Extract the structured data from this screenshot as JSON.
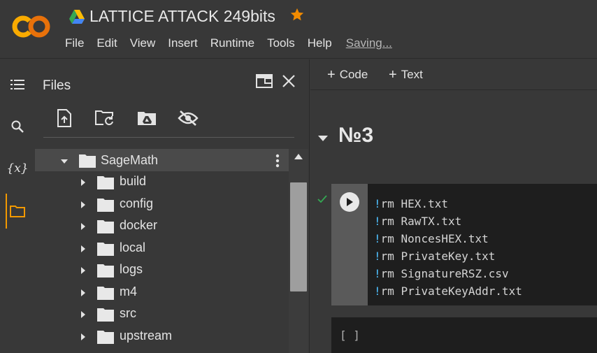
{
  "header": {
    "title": "LATTICE ATTACK 249bits",
    "menu": [
      "File",
      "Edit",
      "View",
      "Insert",
      "Runtime",
      "Tools",
      "Help"
    ],
    "saving": "Saving...",
    "star_color": "#f28b00"
  },
  "rail": {
    "var_label": "{x}",
    "active_color": "#f29900"
  },
  "files": {
    "title": "Files",
    "root": "SageMath",
    "folders": [
      "build",
      "config",
      "docker",
      "local",
      "logs",
      "m4",
      "src",
      "upstream"
    ]
  },
  "notebook": {
    "add_code": "Code",
    "add_text": "Text",
    "section_title": "№3",
    "code_lines": [
      {
        "bang": "!",
        "cmd": "rm HEX.txt"
      },
      {
        "bang": "!",
        "cmd": "rm RawTX.txt"
      },
      {
        "bang": "!",
        "cmd": "rm NoncesHEX.txt"
      },
      {
        "bang": "!",
        "cmd": "rm PrivateKey.txt"
      },
      {
        "bang": "!",
        "cmd": "rm SignatureRSZ.csv"
      },
      {
        "bang": "!",
        "cmd": "rm PrivateKeyAddr.txt"
      }
    ],
    "empty_cell_prompt": "[ ]",
    "status_color": "#34a853"
  }
}
